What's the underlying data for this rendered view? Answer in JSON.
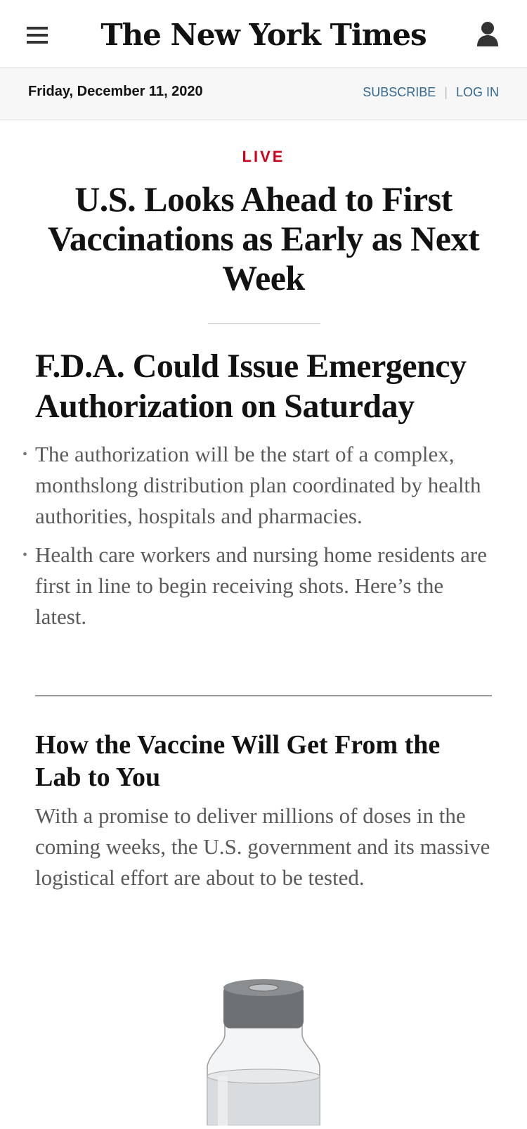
{
  "header": {
    "logo_text": "The New York Times",
    "menu_icon": "hamburger-menu-icon",
    "user_icon": "user-account-icon"
  },
  "datebar": {
    "date": "Friday, December 11, 2020",
    "subscribe_label": "SUBSCRIBE",
    "login_label": "LOG IN",
    "separator": "|"
  },
  "main": {
    "live_label": "LIVE",
    "headline": "U.S. Looks Ahead to First Vaccinations as Early as Next Week",
    "subheadline": "F.D.A. Could Issue Emergency Authorization on Saturday",
    "bullets": [
      "The authorization will be the start of a complex, monthslong distribution plan coordinated by health authorities, hospitals and pharmacies.",
      "Health care workers and nursing home residents are first in line to begin receiving shots. Here’s the latest."
    ],
    "bullet_glyph": "•"
  },
  "story": {
    "title": "How the Vaccine Will Get From the Lab to You",
    "summary": "With a promise to deliver millions of doses in the coming weeks, the U.S. government and its massive logistical effort are about to be tested.",
    "image_icon": "vaccine-vial-icon"
  },
  "colors": {
    "live_red": "#d0021b",
    "link_blue": "#326891",
    "summary_gray": "#5a5a5a"
  }
}
